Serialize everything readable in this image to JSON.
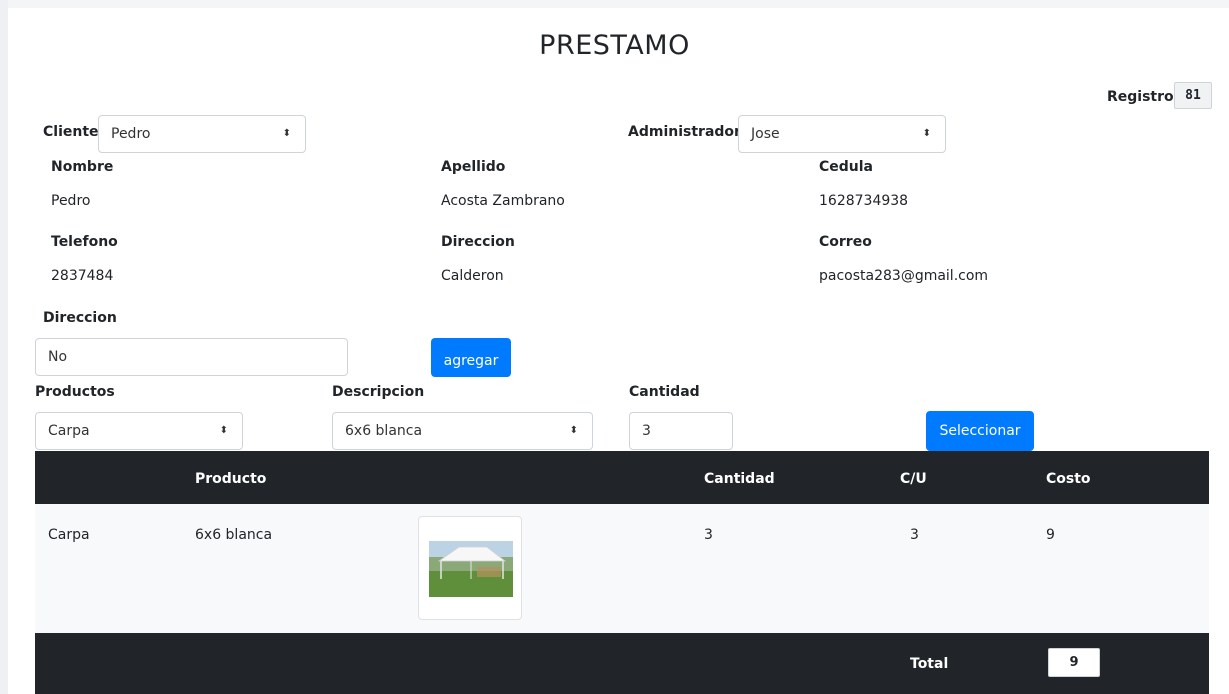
{
  "page": {
    "title": "PRESTAMO"
  },
  "registro": {
    "label": "Registro:",
    "value": "81"
  },
  "cliente": {
    "label": "Cliente",
    "selected": "Pedro"
  },
  "administrador": {
    "label": "Administrador",
    "selected": "Jose"
  },
  "client_info": {
    "nombre_label": "Nombre",
    "nombre": "Pedro",
    "apellido_label": "Apellido",
    "apellido": "Acosta Zambrano",
    "cedula_label": "Cedula",
    "cedula": "1628734938",
    "telefono_label": "Telefono",
    "telefono": "2837484",
    "direccion_label": "Direccion",
    "direccion": "Calderon",
    "correo_label": "Correo",
    "correo": "pacosta283@gmail.com"
  },
  "direccion_input": {
    "label": "Direccion",
    "value": "No"
  },
  "agregar_button": "agregar",
  "productos": {
    "label": "Productos",
    "selected": "Carpa"
  },
  "descripcion": {
    "label": "Descripcion",
    "selected": "6x6 blanca"
  },
  "cantidad": {
    "label": "Cantidad",
    "value": "3"
  },
  "seleccionar_button": "Seleccionar",
  "table": {
    "headers": {
      "producto": "Producto",
      "cantidad": "Cantidad",
      "cu": "C/U",
      "costo": "Costo"
    },
    "rows": [
      {
        "producto": "Carpa",
        "descripcion": "6x6 blanca",
        "cantidad": "3",
        "cu": "3",
        "costo": "9"
      }
    ],
    "total_label": "Total",
    "total_value": "9"
  },
  "icons": {
    "select_arrow": "sort-arrows-icon",
    "product_image": "tent-image"
  },
  "colors": {
    "primary": "#007bff",
    "table_dark": "#212529",
    "row_bg": "#f8f9fa"
  }
}
